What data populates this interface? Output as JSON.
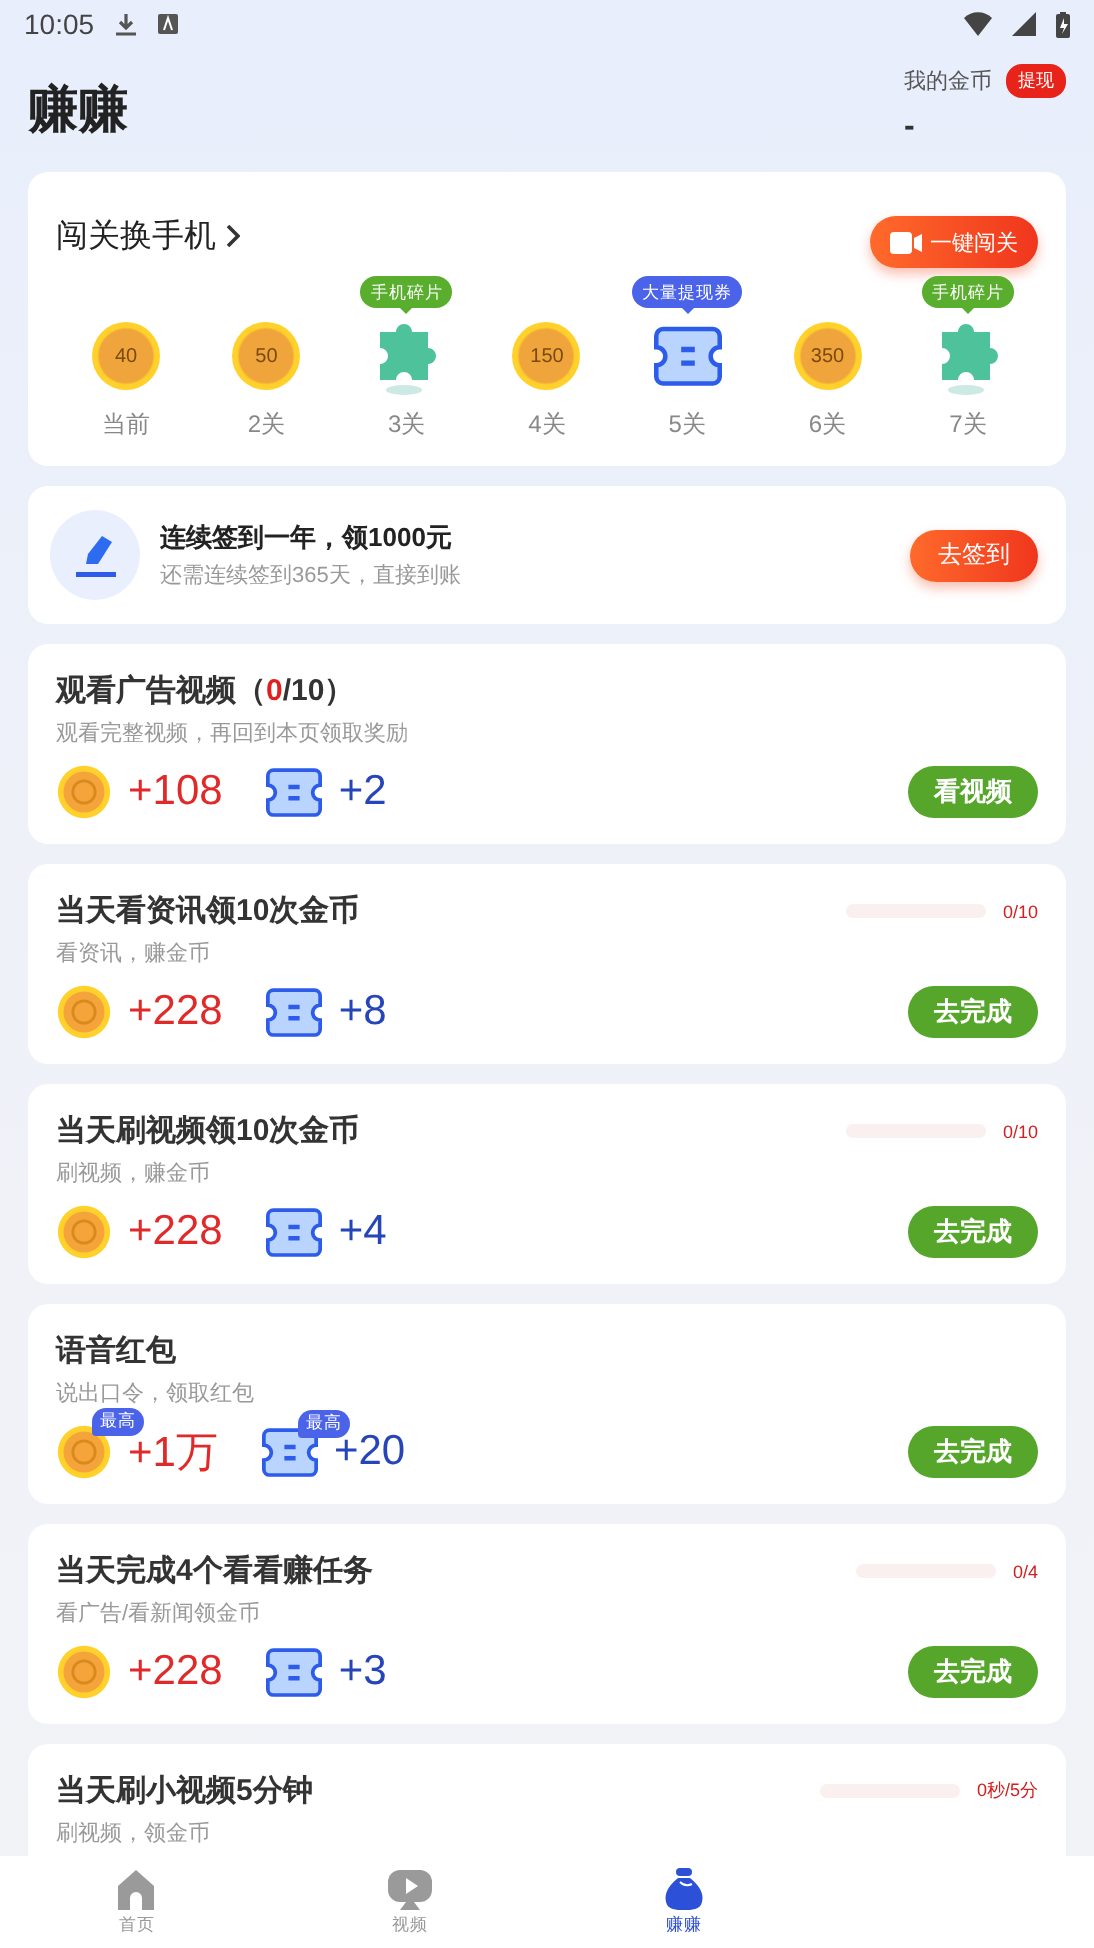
{
  "status_bar": {
    "time": "10:05"
  },
  "header": {
    "title": "赚赚",
    "coins_label": "我的金币",
    "withdraw": "提现",
    "coins_value": "-"
  },
  "levels": {
    "title": "闯关换手机",
    "button": "一键闯关",
    "items": [
      {
        "kind": "coin",
        "value": "40",
        "label": "当前"
      },
      {
        "kind": "coin",
        "value": "50",
        "label": "2关"
      },
      {
        "kind": "puzzle",
        "label": "3关",
        "tag": {
          "text": "手机碎片",
          "color": "#5aae2e"
        }
      },
      {
        "kind": "coin",
        "value": "150",
        "label": "4关"
      },
      {
        "kind": "ticket",
        "label": "5关",
        "tag": {
          "text": "大量提现券",
          "color": "#4a63e8"
        }
      },
      {
        "kind": "coin",
        "value": "350",
        "label": "6关"
      },
      {
        "kind": "puzzle",
        "label": "7关",
        "tag": {
          "text": "手机碎片",
          "color": "#5aae2e"
        }
      }
    ]
  },
  "signin": {
    "title": "连续签到一年，领1000元",
    "subtitle": "还需连续签到365天，直接到账",
    "button": "去签到"
  },
  "tasks": [
    {
      "kind": "counter",
      "title": "观看广告视频（",
      "count": "0",
      "title_end": "/10）",
      "subtitle": "观看完整视频，再回到本页领取奖励",
      "coins": "+108",
      "tickets": "+2",
      "button": "看视频"
    },
    {
      "kind": "progress",
      "title": "当天看资讯领10次金币",
      "level": 0,
      "reading": "0/10",
      "subtitle": "看资讯，赚金币",
      "coins": "+228",
      "tickets": "+8",
      "button": "去完成"
    },
    {
      "kind": "progress",
      "title": "当天刷视频领10次金币",
      "level": 0,
      "reading": "0/10",
      "subtitle": "刷视频，赚金币",
      "coins": "+228",
      "tickets": "+4",
      "button": "去完成"
    },
    {
      "kind": "plain",
      "title": "语音红包",
      "subtitle": "说出口令，领取红包",
      "coins": "+1万",
      "coins_badge": "最高",
      "tickets": "+20",
      "tickets_badge": "最高",
      "button": "去完成"
    },
    {
      "kind": "progress",
      "title": "当天完成4个看看赚任务",
      "level": 0,
      "reading": "0/4",
      "subtitle": "看广告/看新闻领金币",
      "coins": "+228",
      "tickets": "+3",
      "button": "去完成"
    },
    {
      "kind": "progress",
      "title": "当天刷小视频5分钟",
      "level": 0,
      "reading": "0秒/5分",
      "subtitle": "刷视频，领金币"
    }
  ],
  "tab_bar": [
    {
      "label": "首页",
      "selected": false
    },
    {
      "label": "视频",
      "selected": false
    },
    {
      "label": "赚赚",
      "selected": true
    }
  ]
}
